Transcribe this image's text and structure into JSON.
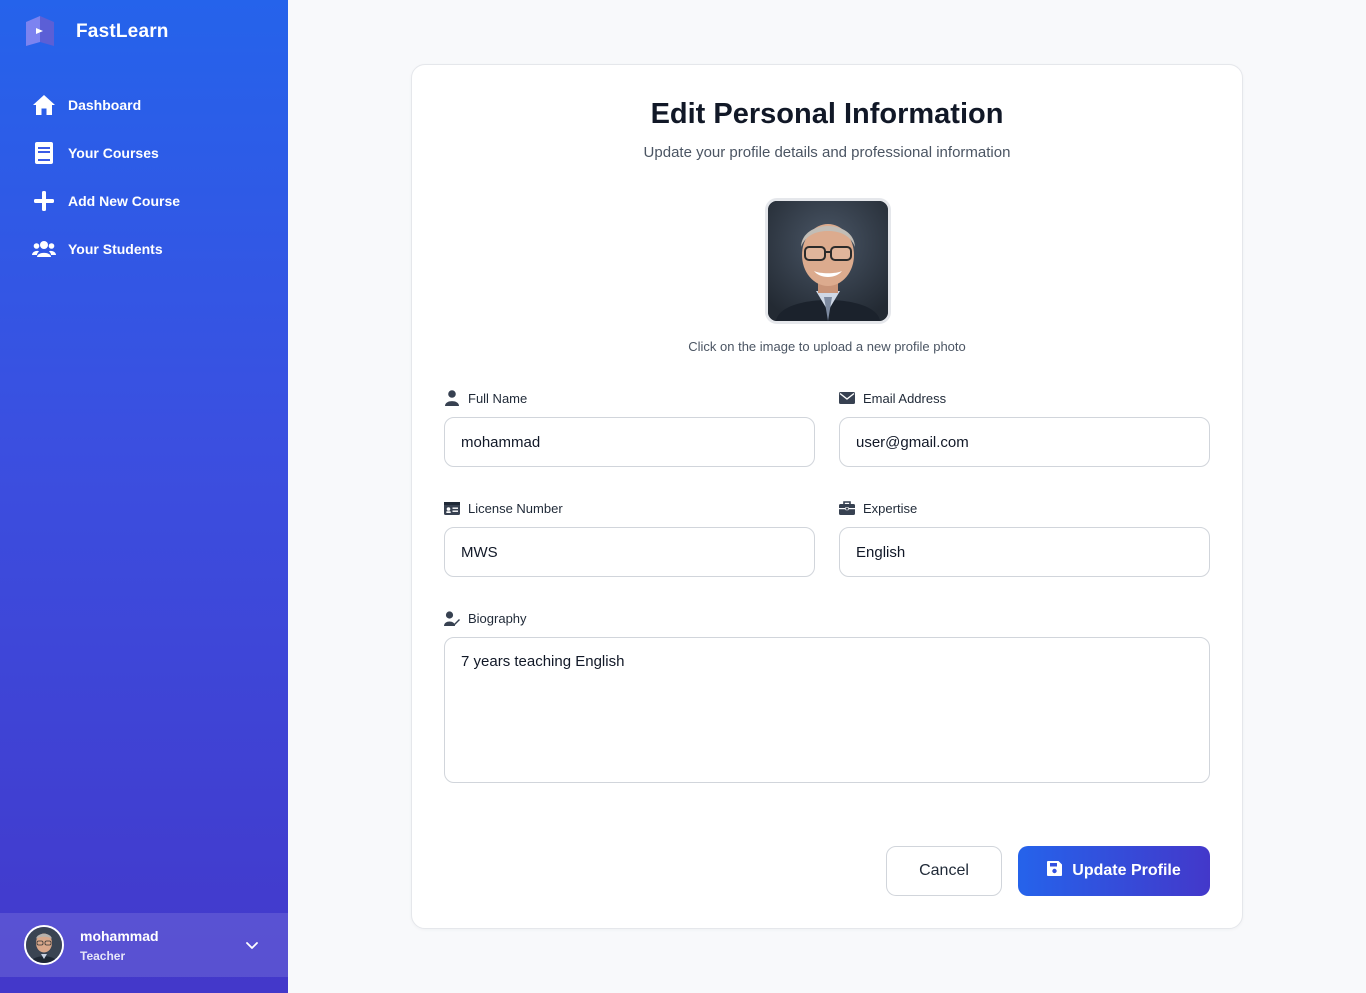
{
  "app": {
    "brand_name": "FastLearn",
    "accent_color": "#2563eb",
    "accent_color_end": "#4338ca"
  },
  "sidebar": {
    "items": [
      {
        "label": "Dashboard",
        "icon": "home-icon"
      },
      {
        "label": "Your Courses",
        "icon": "book-icon"
      },
      {
        "label": "Add New Course",
        "icon": "plus-icon"
      },
      {
        "label": "Your Students",
        "icon": "users-icon"
      }
    ],
    "user": {
      "name": "mohammad",
      "role": "Teacher"
    }
  },
  "form": {
    "title": "Edit Personal Information",
    "subtitle": "Update your profile details and professional information",
    "photo_hint": "Click on the image to upload a new profile photo",
    "fields": {
      "full_name": {
        "label": "Full Name",
        "value": "mohammad",
        "icon": "user-icon"
      },
      "email": {
        "label": "Email Address",
        "value": "user@gmail.com",
        "icon": "envelope-icon"
      },
      "license": {
        "label": "License Number",
        "value": "MWS",
        "icon": "id-card-icon"
      },
      "expertise": {
        "label": "Expertise",
        "value": "English",
        "icon": "briefcase-icon"
      },
      "biography": {
        "label": "Biography",
        "value": "7 years teaching English",
        "icon": "user-pen-icon"
      }
    },
    "cancel_label": "Cancel",
    "update_label": "Update Profile"
  }
}
